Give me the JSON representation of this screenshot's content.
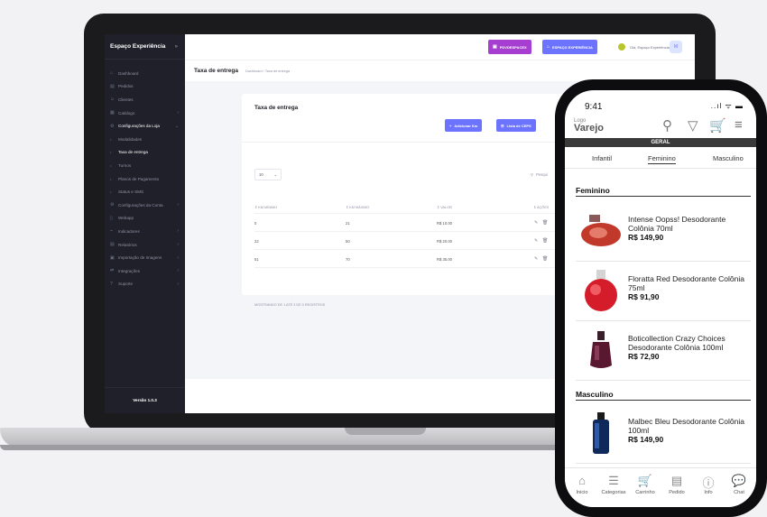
{
  "laptop": {
    "sidebar": {
      "brand": "Espaço Experiência",
      "brand_arrow": "»",
      "items": [
        {
          "label": "Dashboard",
          "icon": "⌂",
          "chev": ""
        },
        {
          "label": "Pedidos",
          "icon": "▤",
          "chev": ""
        },
        {
          "label": "Clientes",
          "icon": "☺",
          "chev": ""
        },
        {
          "label": "Catálogo",
          "icon": "▦",
          "chev": "›"
        },
        {
          "label": "Configurações da Loja",
          "icon": "⚙",
          "chev": "⌄"
        },
        {
          "label": "Modalidades",
          "icon": "•",
          "chev": ""
        },
        {
          "label": "Taxa de entrega",
          "icon": "•",
          "chev": ""
        },
        {
          "label": "Turnos",
          "icon": "•",
          "chev": ""
        },
        {
          "label": "Planos de Pagamento",
          "icon": "•",
          "chev": ""
        },
        {
          "label": "Status e SMS",
          "icon": "•",
          "chev": ""
        },
        {
          "label": "Configurações da Conta",
          "icon": "⚙",
          "chev": "›"
        },
        {
          "label": "Webapp",
          "icon": "▯",
          "chev": ""
        },
        {
          "label": "Indicadores",
          "icon": "⌁",
          "chev": "›"
        },
        {
          "label": "Relatórios",
          "icon": "▤",
          "chev": "›"
        },
        {
          "label": "Importação de Imagens",
          "icon": "▣",
          "chev": "›"
        },
        {
          "label": "Integrações",
          "icon": "⇄",
          "chev": "›"
        },
        {
          "label": "Suporte",
          "icon": "?",
          "chev": "›"
        }
      ],
      "version": "Versão 1.0.3"
    },
    "topbar": {
      "btn_pdv": "PDVDESPACEX",
      "btn_espaco": "ESPAÇO EXPERIÊNCIA",
      "user_greeting": "Olá, Espaço Experiência",
      "avatar": "M",
      "colors": {
        "pdv": "#a63ed1",
        "espaco": "#6c74ff"
      }
    },
    "subbar": {
      "title": "Taxa de entrega",
      "breadcrumb": "Dashboard › Taxa de entrega"
    },
    "card": {
      "title": "Taxa de entrega",
      "btn_add": "Adicionar Km",
      "btn_cep": "Lista de CEPS",
      "per_page": "10",
      "search_placeholder": "Pesqui",
      "headers": [
        "⇕ KM MÍNIMO",
        "⇕ KM MÁXIMO",
        "⇕ VALOR",
        "⇕ AÇÕES"
      ],
      "rows": [
        {
          "min": "0",
          "max": "21",
          "valor": "R$ 10.00"
        },
        {
          "min": "22",
          "max": "50",
          "valor": "R$ 20.00"
        },
        {
          "min": "51",
          "max": "70",
          "valor": "R$ 35.00"
        }
      ],
      "footer": "MOSTRANDO DE 1 ATÉ 3 DE 3 REGISTROS"
    }
  },
  "phone": {
    "time": "9:41",
    "signal": "..ıl ᯤ ▬",
    "logo_small": "Logo",
    "logo_main": "Varejo",
    "geral": "GERAL",
    "tabs": [
      "Infantil",
      "Feminino",
      "Masculino"
    ],
    "sections": [
      {
        "title": "Feminino",
        "products": [
          {
            "name": "Intense Oopss! Desodorante Colônia 70ml",
            "price": "R$ 149,90"
          },
          {
            "name": "Floratta Red Desodorante Colônia 75ml",
            "price": "R$ 91,90"
          },
          {
            "name": "Boticollection Crazy Choices Desodorante Colônia 100ml",
            "price": "R$ 72,90"
          }
        ]
      },
      {
        "title": "Masculino",
        "products": [
          {
            "name": "Malbec Bleu Desodorante Colônia 100ml",
            "price": "R$ 149,90"
          }
        ]
      }
    ],
    "bottom_nav": [
      {
        "label": "Inicio",
        "icon": "⌂"
      },
      {
        "label": "Categorias",
        "icon": "☰"
      },
      {
        "label": "Carrinho",
        "icon": "🛒"
      },
      {
        "label": "Pedido",
        "icon": "▤"
      },
      {
        "label": "Info",
        "icon": "ⓘ"
      },
      {
        "label": "Chat",
        "icon": "💬"
      }
    ]
  }
}
